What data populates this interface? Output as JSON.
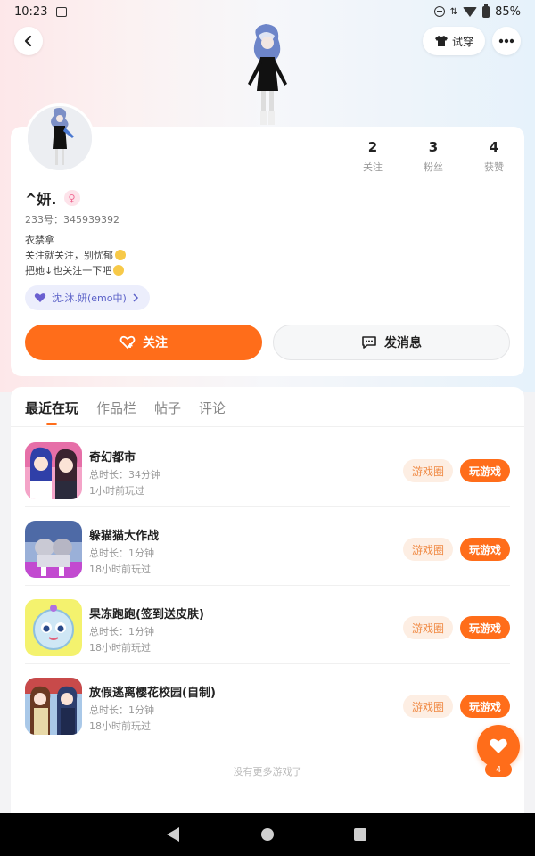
{
  "status_bar": {
    "time": "10:23",
    "battery": "85%"
  },
  "header": {
    "try_on_label": "试穿"
  },
  "profile": {
    "following_count": "2",
    "following_label": "关注",
    "fans_count": "3",
    "fans_label": "粉丝",
    "likes_count": "4",
    "likes_label": "获赞",
    "name": "^妍.",
    "uid": "233号：345939392",
    "bio_line1": "衣禁拿",
    "bio_line2": "关注就关注，别忧郁",
    "bio_line3": "把她↓也关注一下吧",
    "tag_label": "沈.沐.妍(emo中)",
    "follow_label": "关注",
    "message_label": "发消息"
  },
  "tabs": [
    "最近在玩",
    "作品栏",
    "帖子",
    "评论"
  ],
  "games": [
    {
      "name": "奇幻都市",
      "duration": "总时长：34分钟",
      "last_played": "1小时前玩过"
    },
    {
      "name": "躲猫猫大作战",
      "duration": "总时长：1分钟",
      "last_played": "18小时前玩过"
    },
    {
      "name": "果冻跑跑(签到送皮肤)",
      "duration": "总时长：1分钟",
      "last_played": "18小时前玩过"
    },
    {
      "name": "放假逃离樱花校园(自制)",
      "duration": "总时长：1分钟",
      "last_played": "18小时前玩过"
    }
  ],
  "buttons": {
    "circle": "游戏圈",
    "play": "玩游戏"
  },
  "no_more_text": "没有更多游戏了",
  "fab_count": "4",
  "colors": {
    "accent": "#ff6d1a",
    "tag_bg": "#eceefc",
    "tag_text": "#5b61c8"
  }
}
